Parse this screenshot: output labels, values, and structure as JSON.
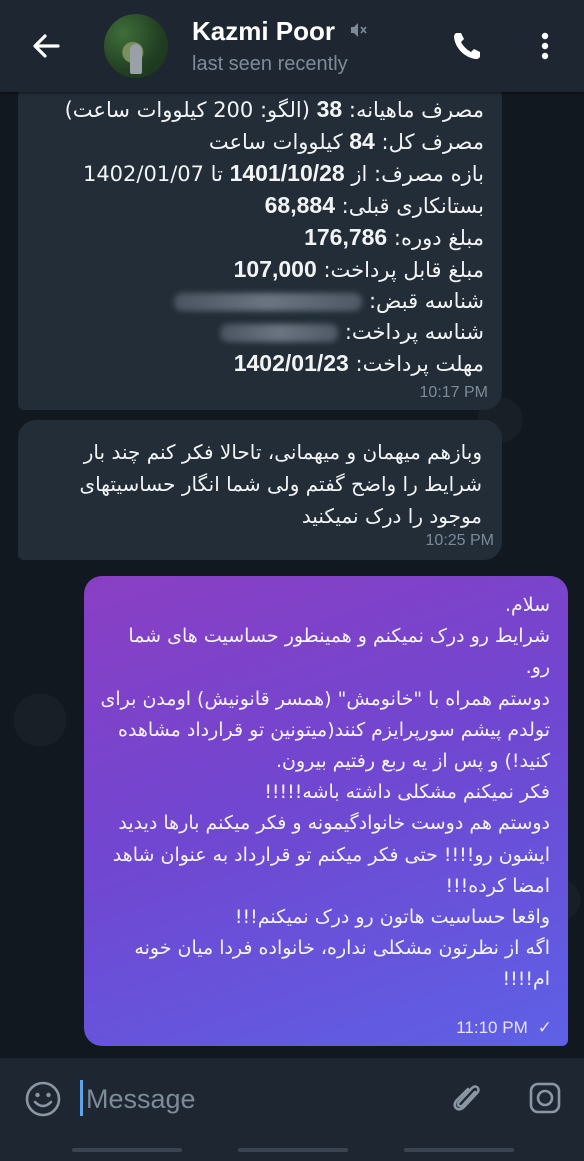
{
  "header": {
    "contact_name": "Kazmi Poor",
    "status": "last seen recently"
  },
  "messages": [
    {
      "direction": "incoming",
      "lines": [
        {
          "before": "مصرف ماهیانه: ",
          "value": "38",
          "after": " (الگو: 200 کیلووات ساعت)"
        },
        {
          "before": "مصرف کل: ",
          "value": "84",
          "after": " کیلووات ساعت"
        },
        {
          "before": "بازه مصرف: از ",
          "value": "1401/10/28",
          "after": " تا 1402/01/07"
        },
        {
          "before": "بستانکاری قبلی: ",
          "value": "68,884",
          "after": ""
        },
        {
          "before": "مبلغ دوره: ",
          "value": "176,786",
          "after": ""
        },
        {
          "before": "مبلغ قابل پرداخت: ",
          "value": "107,000",
          "after": ""
        },
        {
          "before": "شناسه قبض: ",
          "value": "",
          "after": ""
        },
        {
          "before": "شناسه پرداخت: ",
          "value": "",
          "after": ""
        },
        {
          "before": "مهلت پرداخت: ",
          "value": "1402/01/23",
          "after": ""
        }
      ],
      "time": "10:17 PM"
    },
    {
      "direction": "incoming",
      "text": "وبازهم میهمان و میهمانی، تاحالا فکر کنم چند بار شرایط را  واضح گفتم ولی شما انگار حساسیتهای موجود را درک نمیکنید",
      "time": "10:25 PM"
    },
    {
      "direction": "outgoing",
      "text": "سلام.\nشرایط رو درک نمیکنم و همینطور حساسیت های شما رو.\nدوستم همراه با \"خانومش\" (همسر قانونیش) اومدن برای تولدم پیشم سورپرایزم کنند(میتونین تو قرارداد مشاهده کنید!) و پس از یه ربع رفتیم بیرون.\nفکر نمیکنم مشکلی داشته باشه!!!!!\nدوستم هم دوست خانوادگیمونه و فکر میکنم بارها دیدید ایشون رو!!!! حتی فکر میکنم تو قرارداد به عنوان شاهد امضا کرده!!!\nواقعا حساسیت هاتون رو درک نمیکنم!!!\nاگه از نظرتون مشکلی نداره، خانواده فردا میان خونه ام!!!!",
      "time": "11:10 PM",
      "status_icon": "single-check"
    }
  ],
  "input": {
    "placeholder": "Message"
  },
  "colors": {
    "header_bg": "#1e2731",
    "incoming_bubble": "#222d38",
    "outgoing_gradient_start": "#8a3fc4",
    "outgoing_gradient_end": "#5d61e6",
    "accent": "#5ea5e8"
  }
}
